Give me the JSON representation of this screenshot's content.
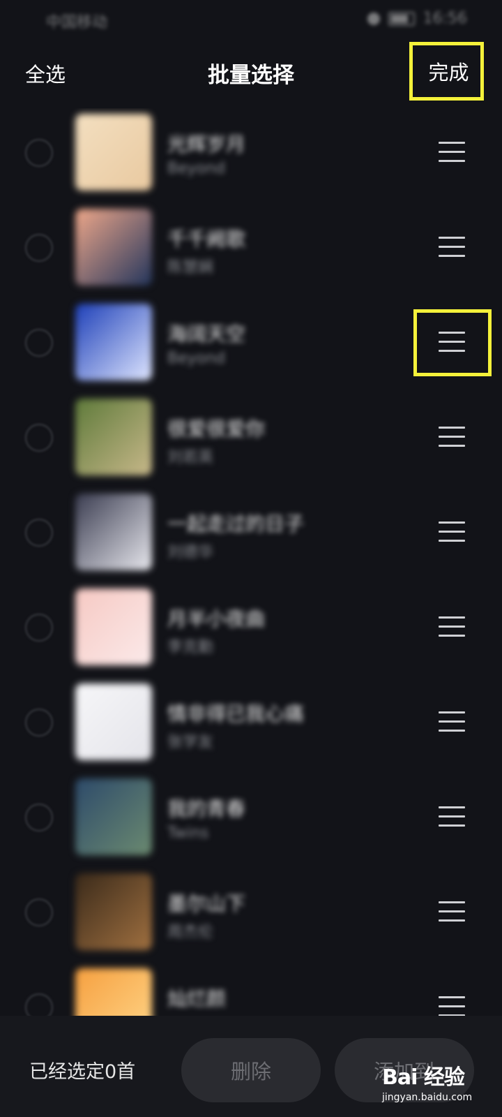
{
  "status_bar": {
    "carrier": "中国移动",
    "time": "16:56"
  },
  "header": {
    "select_all": "全选",
    "title": "批量选择",
    "done": "完成"
  },
  "songs": [
    {
      "title": "光辉岁月",
      "artist": "Beyond",
      "cover": [
        "#f3dfc0",
        "#e9c9a0"
      ]
    },
    {
      "title": "千千阙歌",
      "artist": "陈慧娴",
      "cover": [
        "#f0a88a",
        "#23355c"
      ]
    },
    {
      "title": "海阔天空",
      "artist": "Beyond",
      "cover": [
        "#1d3fb8",
        "#dfe6ff"
      ]
    },
    {
      "title": "很爱很爱你",
      "artist": "刘若英",
      "cover": [
        "#5e7a3a",
        "#c8b88a"
      ]
    },
    {
      "title": "一起走过的日子",
      "artist": "刘德华",
      "cover": [
        "#3a3c50",
        "#e8e8ee"
      ]
    },
    {
      "title": "月半小夜曲",
      "artist": "李克勤",
      "cover": [
        "#f6c9c3",
        "#fbeaea"
      ]
    },
    {
      "title": "情非得已我心痛",
      "artist": "张学友",
      "cover": [
        "#f6f6f8",
        "#e4e4ea"
      ]
    },
    {
      "title": "我的青春",
      "artist": "Twins",
      "cover": [
        "#2d4a6a",
        "#6b8a70"
      ]
    },
    {
      "title": "墨尔山下",
      "artist": "周杰伦",
      "cover": [
        "#3a2a1a",
        "#a07040"
      ]
    },
    {
      "title": "灿烂颜",
      "artist": "",
      "cover": [
        "#f6a040",
        "#ffd78a"
      ]
    }
  ],
  "bottom_bar": {
    "selected_count": "已经选定0首",
    "delete": "删除",
    "add_to": "添加到"
  },
  "watermark": {
    "logo": "Bai 经验",
    "url": "jingyan.baidu.com"
  },
  "colors": {
    "background": "#121318",
    "highlight": "#f4f13a"
  }
}
